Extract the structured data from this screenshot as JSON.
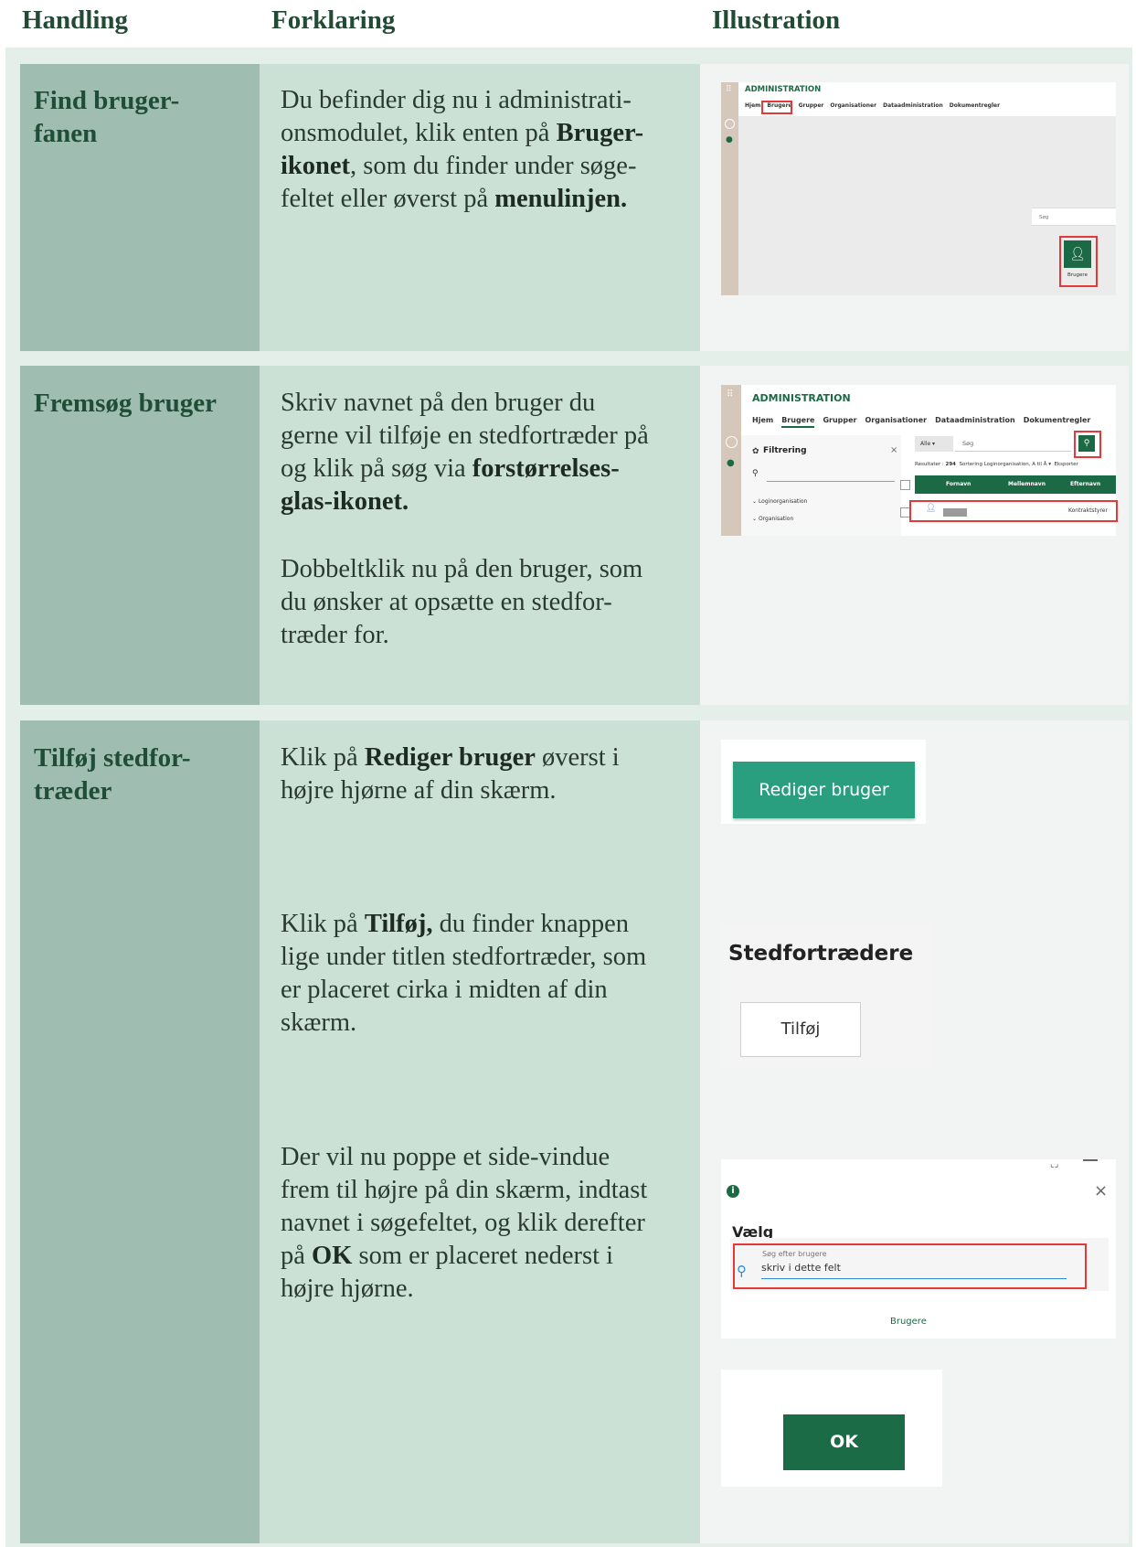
{
  "headers": {
    "handling": "Handling",
    "forklaring": "Forklaring",
    "illustration": "Illustration"
  },
  "rows": [
    {
      "action_line1": "Find bruger-",
      "action_line2": "fanen",
      "text": [
        {
          "t": "Du befinder dig nu i administrati-\nonsmodulet, klik enten på "
        },
        {
          "b": "Bruger-\nikonet"
        },
        {
          "t": ", som du finder under søge-\nfeltet eller øverst på "
        },
        {
          "b": "menulinjen."
        }
      ],
      "illus": {
        "title": "ADMINISTRATION",
        "tabs": [
          "Hjem",
          "Brugere",
          "Grupper",
          "Organisationer",
          "Dataadministration",
          "Dokumentregler"
        ],
        "search_placeholder": "Søg",
        "tile_label": "Brugere"
      }
    },
    {
      "action_line1": "Fremsøg bruger",
      "text": [
        {
          "t": "Skriv navnet på den bruger du\ngerne vil tilføje en stedfortræder på\nog klik på søg via "
        },
        {
          "b": "forstørrelses-\nglas-ikonet."
        }
      ],
      "text2": "Dobbeltklik nu på den bruger, som\ndu ønsker at opsætte en stedfor-\ntræder for.",
      "illus": {
        "title": "ADMINISTRATION",
        "tabs": [
          "Hjem",
          "Brugere",
          "Grupper",
          "Organisationer",
          "Dataadministration",
          "Dokumentregler"
        ],
        "filter_label": "Filtrering",
        "filter_close": "×",
        "dropdown_value": "Alle",
        "search_placeholder": "Søg",
        "results_label": "Resultater :",
        "results_count": "294",
        "sort_label": "Sortering",
        "sort_value": "Loginorganisation, A til Å",
        "export_label": "Eksporter",
        "columns": [
          "Fornavn",
          "Mellemnavn",
          "Efternavn"
        ],
        "tree_items": [
          "Loginorganisation",
          "Organisation"
        ],
        "row_value": "Kontraktstyrer"
      }
    },
    {
      "action_line1": "Tilføj stedfor-",
      "action_line2": "træder",
      "text": [
        {
          "t": "Klik på "
        },
        {
          "b": "Rediger bruger"
        },
        {
          "t": " øverst i\nhøjre hjørne af din skærm."
        }
      ],
      "text2": [
        {
          "t": "Klik på "
        },
        {
          "b": "Tilføj,"
        },
        {
          "t": " du finder knappen\nlige under titlen stedfortræder, som\ner placeret cirka i midten af din\nskærm."
        }
      ],
      "text3": [
        {
          "t": "Der vil nu poppe et side-vindue\nfrem til højre på din skærm, indtast\nnavnet i søgefeltet, og klik derefter\npå "
        },
        {
          "b": "OK"
        },
        {
          "t": " som er placeret nederst i\nhøjre hjørne."
        }
      ],
      "illus": {
        "edit_button": "Rediger bruger",
        "section_title": "Stedfortrædere",
        "add_button": "Tilføj",
        "panel_heading": "Vælg",
        "search_label": "Søg efter brugere",
        "search_value": "skriv i dette felt",
        "tab_label": "Brugere",
        "close_glyph": "×",
        "ok_button": "OK"
      }
    }
  ]
}
